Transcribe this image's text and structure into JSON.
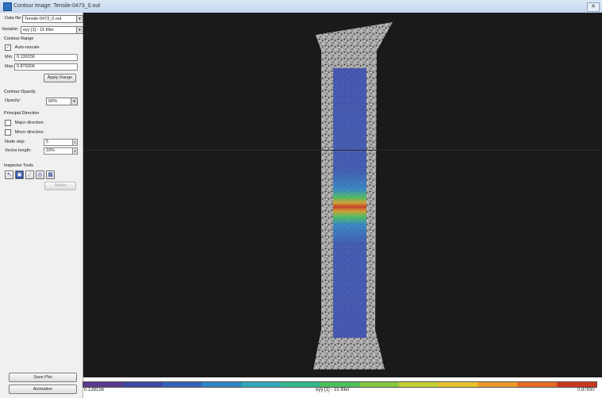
{
  "window": {
    "title": "Contour Image: Tensile-0473_0.out"
  },
  "panel": {
    "data_file_label": "Data file:",
    "data_file_value": "Tensile-0473_0.out",
    "variable_label": "Variable:",
    "variable_value": "eyy [1] - 15 filter",
    "contour_range_title": "Contour Range",
    "auto_rescale_label": "Auto-rescale",
    "auto_rescale_checked": true,
    "min_label": "Min:",
    "min_value": "0.139156",
    "max_label": "Max:",
    "max_value": "0.879306",
    "apply_range_label": "Apply Range",
    "contour_opacity_title": "Contour Opacity",
    "opacity_label": "Opacity:",
    "opacity_value": "60%",
    "principal_direction_title": "Principal Direction",
    "major_direction_label": "Major direction",
    "minor_direction_label": "Minor direction",
    "node_skip_label": "Node skip:",
    "node_skip_value": "5",
    "vector_length_label": "Vector length:",
    "vector_length_value": "10%",
    "inspector_tools_title": "Inspector Tools",
    "select_label": "Select",
    "save_plot_label": "Save Plot",
    "animation_label": "Animation"
  },
  "colorbar": {
    "min_label": "0.139156",
    "max_label": "0.87930",
    "title": "eyy [1] - 15 filter",
    "colors": [
      "#5a3a8c",
      "#3f49a3",
      "#3463b8",
      "#2f86c4",
      "#2fa8b8",
      "#34b88e",
      "#4cbf5a",
      "#86c83f",
      "#c6cf33",
      "#e8c22d",
      "#eb9a29",
      "#e46a25",
      "#c9371f"
    ]
  }
}
